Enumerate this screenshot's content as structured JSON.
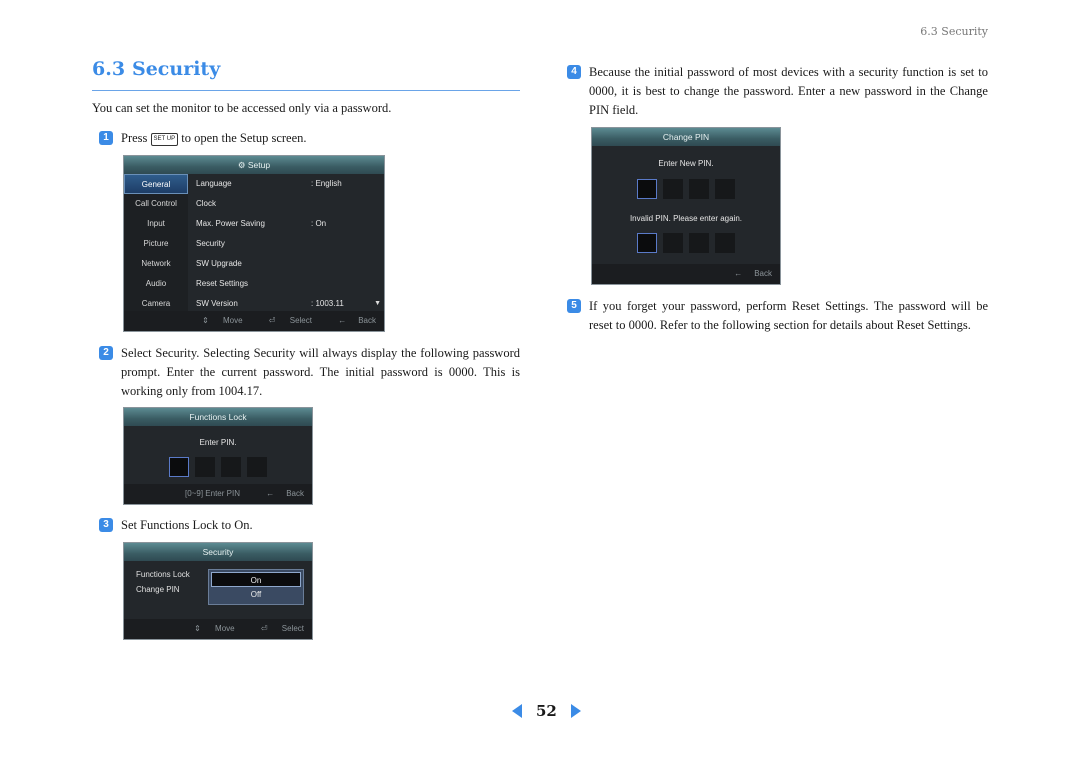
{
  "header": {
    "running_title": "6.3 Security"
  },
  "section": {
    "number": "6.3",
    "title": "Security"
  },
  "intro": "You can set the monitor to be accessed only via a password.",
  "steps": [
    {
      "num": "1",
      "text_before": "Press",
      "key_label": "SET UP",
      "text_after": "to open the Setup screen."
    },
    {
      "num": "2",
      "text": "Select Security.  Selecting Security will always display the following password prompt. Enter the current password. The initial password is 0000. This is working only from 1004.17."
    },
    {
      "num": "3",
      "text": "Set Functions Lock to On."
    },
    {
      "num": "4",
      "text": "Because the initial password of most devices with a security function is set to 0000, it is best to change the password. Enter a new password in the Change PIN field."
    },
    {
      "num": "5",
      "text": "If you forget your password, perform Reset Settings.  The password will be reset to 0000.  Refer to the following section for details about Reset Settings."
    }
  ],
  "setup_screen": {
    "title": "Setup",
    "title_icon": "gear-icon",
    "sidebar": [
      "General",
      "Call Control",
      "Input",
      "Picture",
      "Network",
      "Audio",
      "Camera"
    ],
    "selected_sidebar": "General",
    "rows": [
      {
        "label": "Language",
        "value": ": English"
      },
      {
        "label": "Clock",
        "value": ""
      },
      {
        "label": "Max. Power Saving",
        "value": ": On"
      },
      {
        "label": "Security",
        "value": ""
      },
      {
        "label": "SW Upgrade",
        "value": ""
      },
      {
        "label": "Reset Settings",
        "value": ""
      },
      {
        "label": "SW Version",
        "value": ": 1003.11"
      }
    ],
    "footer": {
      "move": "Move",
      "select": "Select",
      "back": "Back"
    }
  },
  "functions_lock_screen": {
    "title": "Functions Lock",
    "prompt": "Enter PIN.",
    "pin_digits": 4,
    "footer": {
      "enter": "[0~9] Enter PIN",
      "back": "Back"
    }
  },
  "security_screen": {
    "title": "Security",
    "labels": [
      "Functions Lock",
      "Change PIN"
    ],
    "options": [
      "On",
      "Off"
    ],
    "selected_option": "On",
    "footer": {
      "move": "Move",
      "select": "Select",
      "back": "Back"
    }
  },
  "change_pin_screen": {
    "title": "Change PIN",
    "prompt": "Enter New PIN.",
    "error": "Invalid PIN. Please enter again.",
    "footer": {
      "back": "Back"
    }
  },
  "pager": {
    "page": "52"
  },
  "colors": {
    "accent": "#3b8be6"
  }
}
